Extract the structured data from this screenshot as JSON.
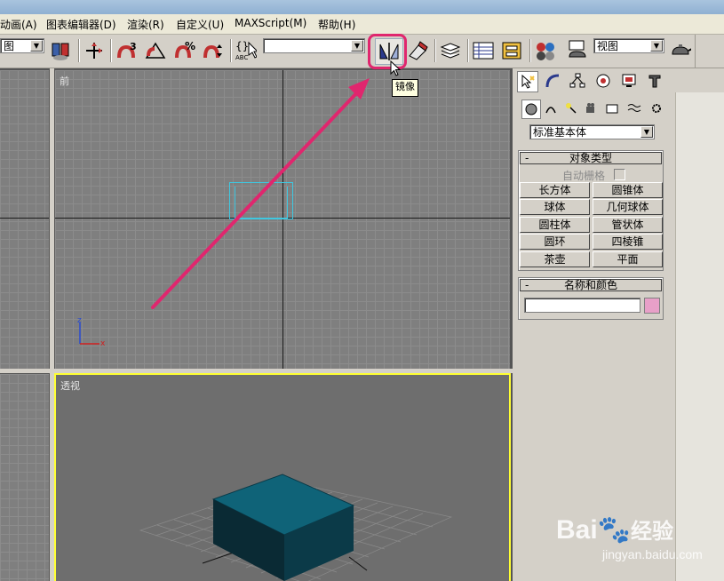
{
  "menu": {
    "items": [
      "动画(A)",
      "图表编辑器(D)",
      "渲染(R)",
      "自定义(U)",
      "MAXScript(M)",
      "帮助(H)"
    ]
  },
  "toolbar": {
    "selection_set_value": "图",
    "named_sel_value": "",
    "ref_coord_value": "视图",
    "spinner_label_3": "3",
    "percent_label": "%",
    "abc_label": "ABC",
    "braces_label": "{}"
  },
  "tooltip": {
    "text": "镜像"
  },
  "viewports": {
    "front_label": "前",
    "perspective_label": "透视",
    "axis_z": "z",
    "axis_x": "x"
  },
  "command_panel": {
    "category_value": "标准基本体",
    "object_type": {
      "title": "对象类型",
      "collapse": "-",
      "autogrid_label": "自动栅格",
      "buttons": [
        "长方体",
        "圆锥体",
        "球体",
        "几何球体",
        "圆柱体",
        "管状体",
        "圆环",
        "四棱锥",
        "茶壶",
        "平面"
      ]
    },
    "name_color": {
      "title": "名称和颜色",
      "collapse": "-",
      "name_value": "",
      "color": "#e8a0c8"
    }
  },
  "watermark": {
    "brand": "Bai",
    "brand_tail": "经验",
    "url": "jingyan.baidu.com"
  },
  "colors": {
    "annotation": "#e0266e",
    "selection_cyan": "#3fc7e0",
    "box_teal": "#0f5a6e",
    "active_viewport_border": "#ffff32"
  }
}
